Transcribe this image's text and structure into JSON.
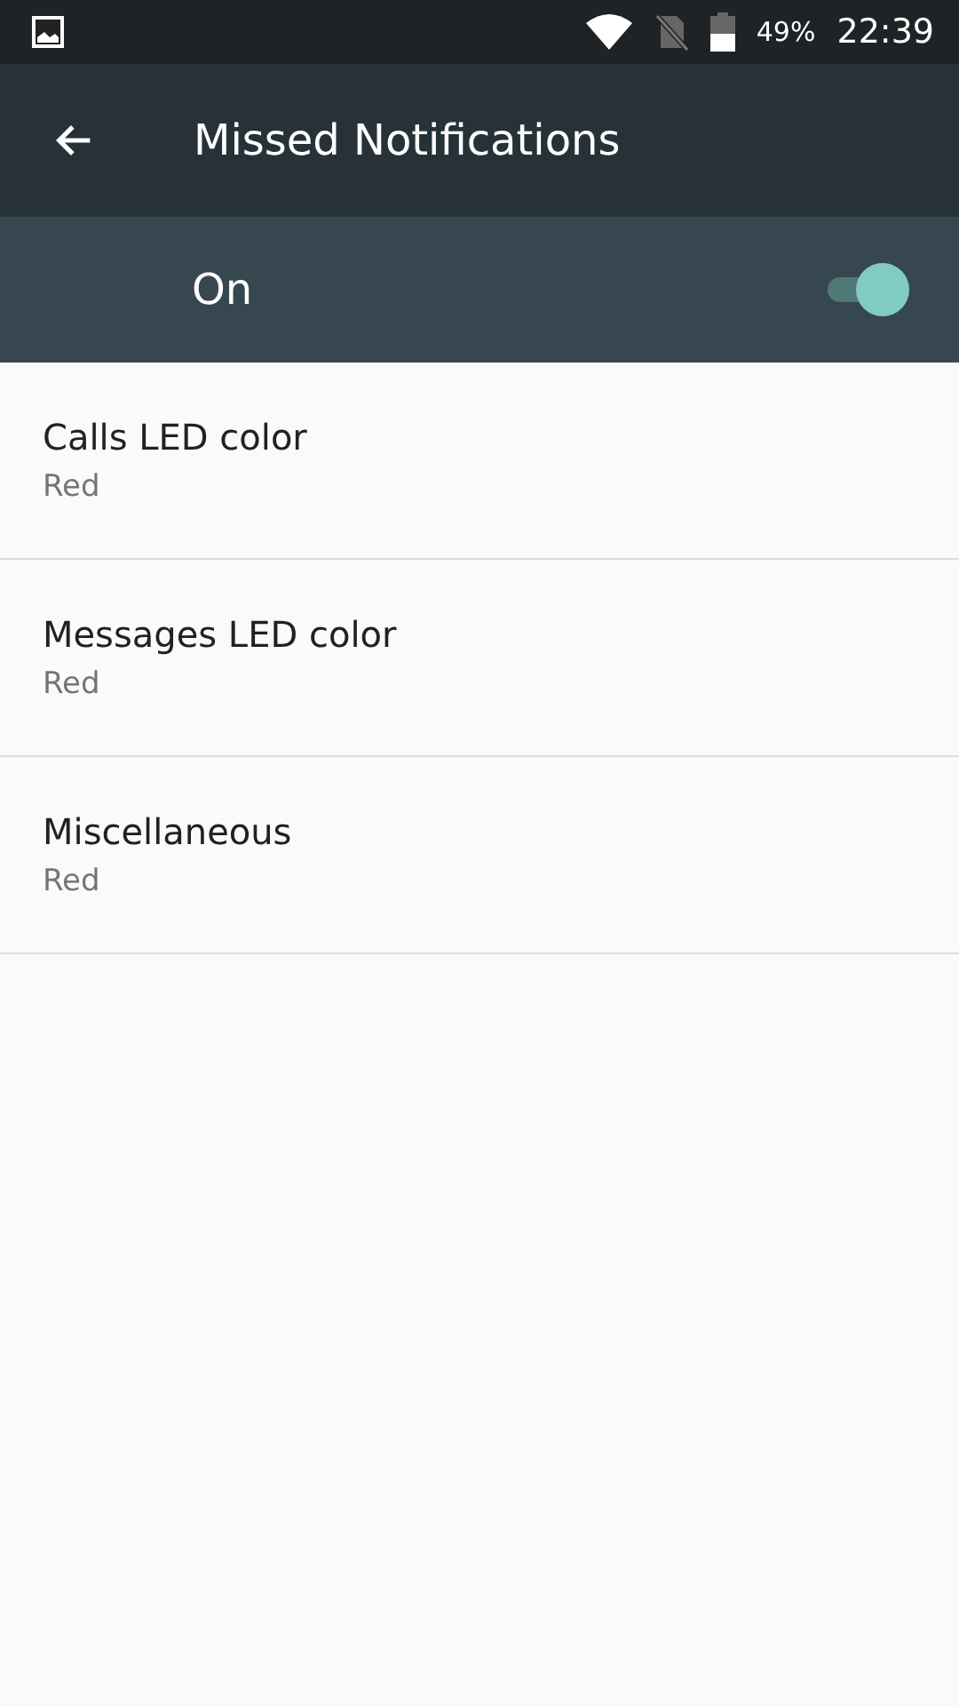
{
  "status_bar": {
    "battery": "49%",
    "time": "22:39"
  },
  "app_bar": {
    "title": "Missed Notifications"
  },
  "master_switch": {
    "label": "On",
    "on": true
  },
  "settings": [
    {
      "title": "Calls LED color",
      "value": "Red"
    },
    {
      "title": "Messages LED color",
      "value": "Red"
    },
    {
      "title": "Miscellaneous",
      "value": "Red"
    }
  ]
}
